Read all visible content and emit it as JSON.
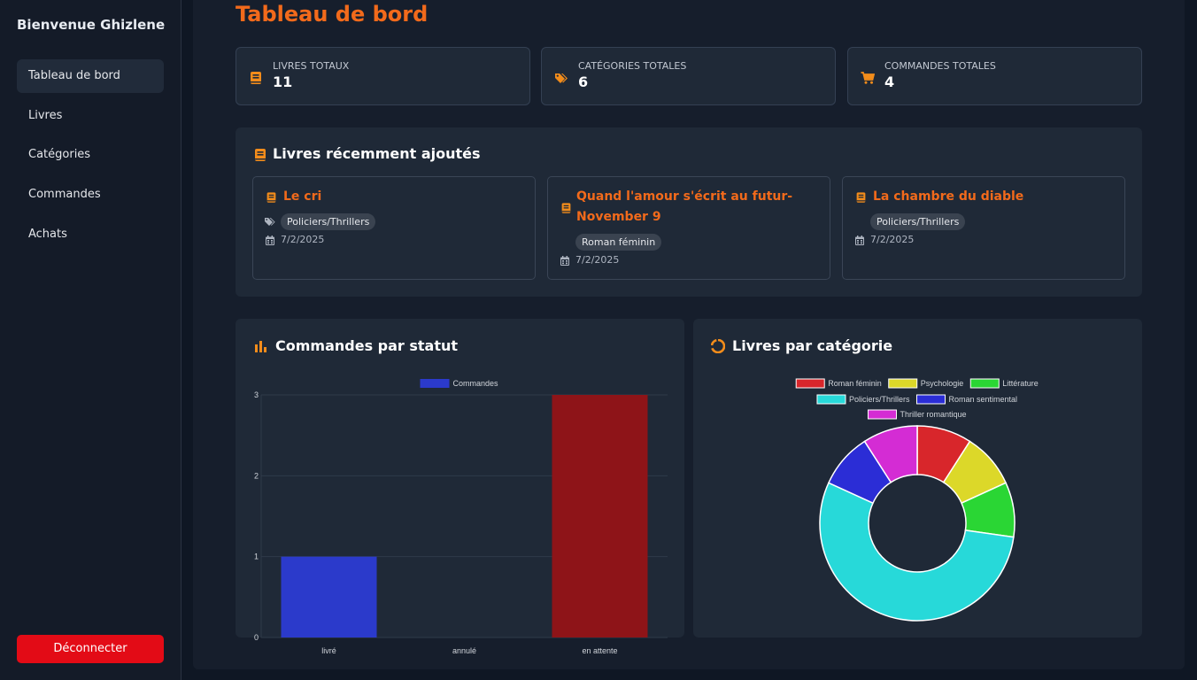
{
  "sidebar": {
    "welcome": "Bienvenue Ghizlene",
    "items": [
      {
        "label": "Tableau de bord"
      },
      {
        "label": "Livres"
      },
      {
        "label": "Catégories"
      },
      {
        "label": "Commandes"
      },
      {
        "label": "Achats"
      }
    ],
    "logout": "Déconnecter"
  },
  "page": {
    "title": "Tableau de bord"
  },
  "stats": [
    {
      "label": "LIVRES TOTAUX",
      "value": "11",
      "icon": "book-icon"
    },
    {
      "label": "CATÉGORIES TOTALES",
      "value": "6",
      "icon": "tags-icon"
    },
    {
      "label": "COMMANDES TOTALES",
      "value": "4",
      "icon": "cart-icon"
    }
  ],
  "recent": {
    "title": "Livres récemment ajoutés",
    "books": [
      {
        "title": "Le cri",
        "category": "Policiers/Thrillers",
        "date": "7/2/2025"
      },
      {
        "title": "Quand l'amour s'écrit au futur- November 9",
        "category": "Roman féminin",
        "date": "7/2/2025"
      },
      {
        "title": "La chambre du diable",
        "category": "Policiers/Thrillers",
        "date": "7/2/2025"
      }
    ]
  },
  "orders_panel": {
    "title": "Commandes par statut"
  },
  "category_panel": {
    "title": "Livres par catégorie"
  },
  "colors": {
    "accent": "#f26a1b",
    "logout": "#e30b16",
    "bar_livre": "#2b3acb",
    "bar_en_attente": "#8e1418"
  },
  "chart_data": [
    {
      "type": "bar",
      "categories": [
        "livré",
        "annulé",
        "en attente"
      ],
      "series": [
        {
          "name": "Commandes",
          "values": [
            1,
            0,
            3
          ]
        }
      ],
      "ylim": [
        0,
        3
      ],
      "yticks": [
        0,
        1,
        2,
        3
      ],
      "grid": true,
      "legend": "top"
    },
    {
      "type": "pie",
      "donut": true,
      "labels": [
        "Roman féminin",
        "Psychologie",
        "Littérature",
        "Policiers/Thrillers",
        "Roman sentimental",
        "Thriller romantique"
      ],
      "values": [
        1,
        1,
        1,
        6,
        1,
        1
      ],
      "colors": [
        "#d8262b",
        "#dcd829",
        "#2ad634",
        "#27d9d9",
        "#2b2dd6",
        "#d42cd4"
      ],
      "legend": "top"
    }
  ]
}
